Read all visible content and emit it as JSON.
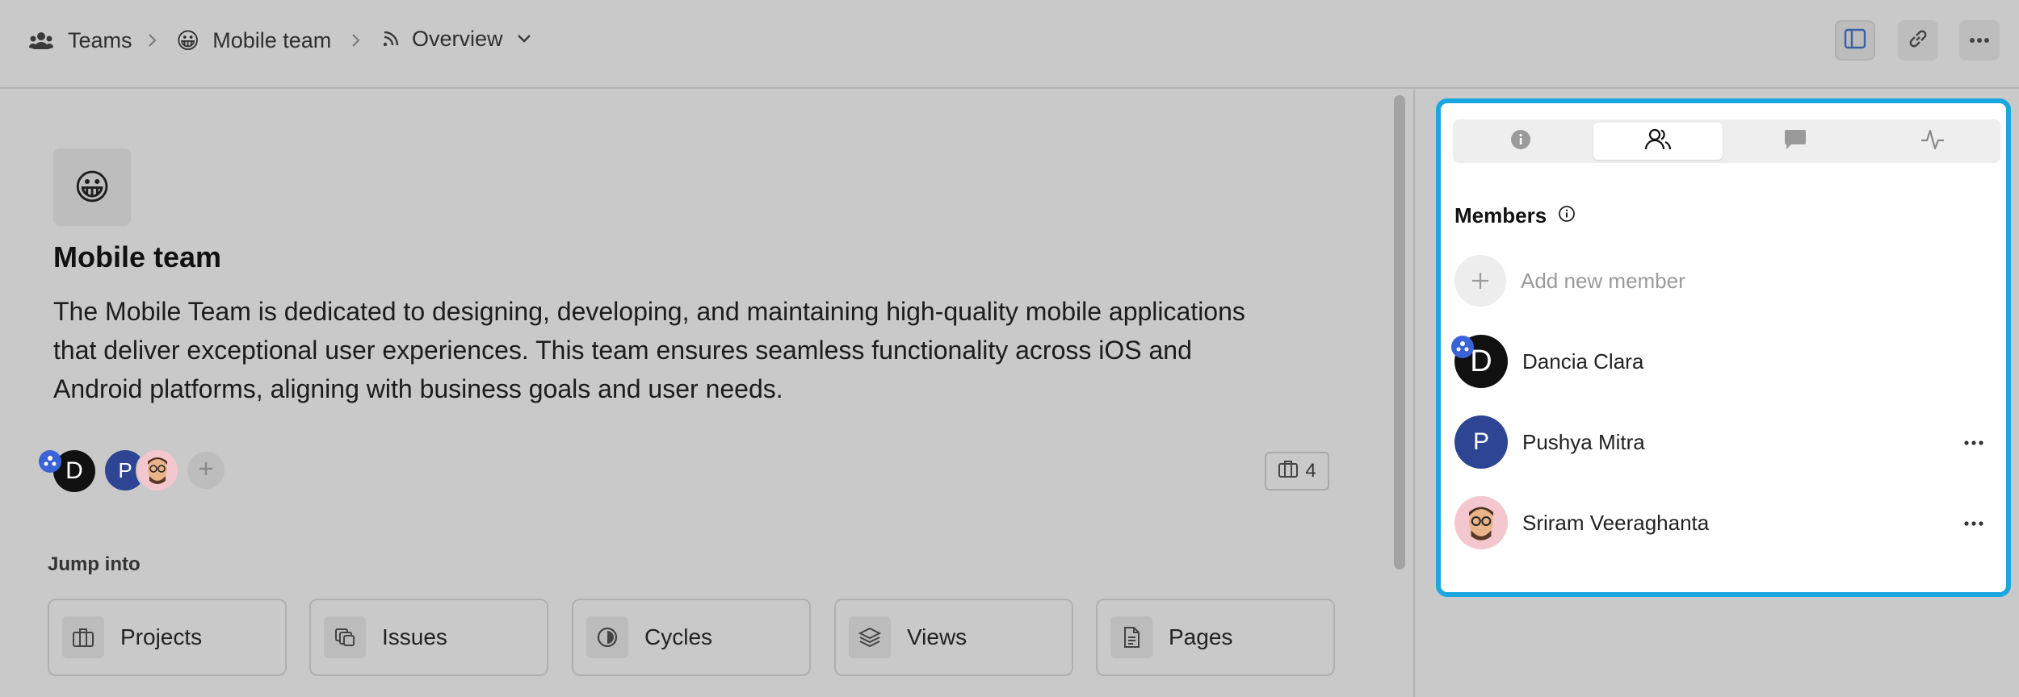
{
  "breadcrumb": {
    "teams": "Teams",
    "team_emoji": "😀",
    "team_name": "Mobile team",
    "view": "Overview"
  },
  "team": {
    "emoji": "😀",
    "name": "Mobile team",
    "description": "The Mobile Team is dedicated to designing, developing, and maintaining high-quality mobile applications that deliver exceptional user experiences. This team ensures seamless functionality across iOS and Android platforms, aligning with business goals and user needs.",
    "projects_count": "4"
  },
  "avatars": [
    {
      "initial": "D",
      "color": "#111111"
    },
    {
      "initial": "P",
      "color": "#2d4592"
    }
  ],
  "jump": {
    "label": "Jump into",
    "items": [
      {
        "label": "Projects",
        "icon": "briefcase-icon"
      },
      {
        "label": "Issues",
        "icon": "layers-icon"
      },
      {
        "label": "Cycles",
        "icon": "contrast-icon"
      },
      {
        "label": "Views",
        "icon": "stack-icon"
      },
      {
        "label": "Pages",
        "icon": "document-icon"
      }
    ]
  },
  "panel": {
    "tabs": [
      "info-icon",
      "members-icon",
      "comment-icon",
      "activity-icon"
    ],
    "active_tab": 1,
    "members_title": "Members",
    "add_member": "Add new member",
    "members": [
      {
        "name": "Dancia Clara",
        "initial": "D",
        "color": "#111111",
        "lead": true
      },
      {
        "name": "Pushya Mitra",
        "initial": "P",
        "color": "#2d4592"
      },
      {
        "name": "Sriram Veeraghanta",
        "initial": "",
        "color": "#f4c7cf"
      }
    ]
  },
  "colors": {
    "accent": "#1aa7e0",
    "lead_badge": "#3b63d8"
  }
}
